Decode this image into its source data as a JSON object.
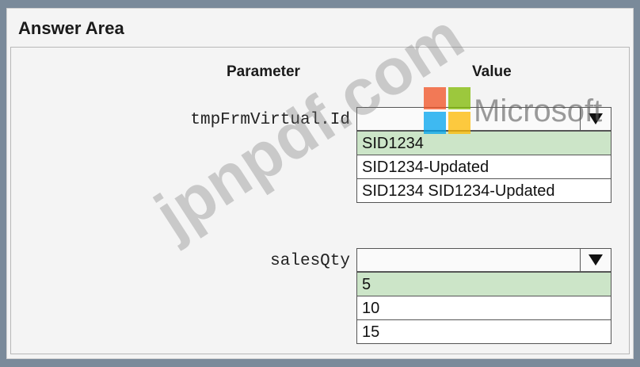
{
  "title": "Answer Area",
  "headers": {
    "parameter": "Parameter",
    "value": "Value"
  },
  "rows": [
    {
      "parameter": "tmpFrmVirtual.Id",
      "selected": "",
      "options": [
        "SID1234",
        "SID1234-Updated",
        "SID1234 SID1234-Updated"
      ]
    },
    {
      "parameter": "salesQty",
      "selected": "",
      "options": [
        "5",
        "10",
        "15"
      ]
    }
  ],
  "watermark": {
    "text": "jpnpdf.com",
    "brand": "Microsoft",
    "logo_colors": [
      "#f25022",
      "#7fba00",
      "#00a4ef",
      "#ffb900"
    ]
  },
  "highlight_color": "#cce5c8"
}
